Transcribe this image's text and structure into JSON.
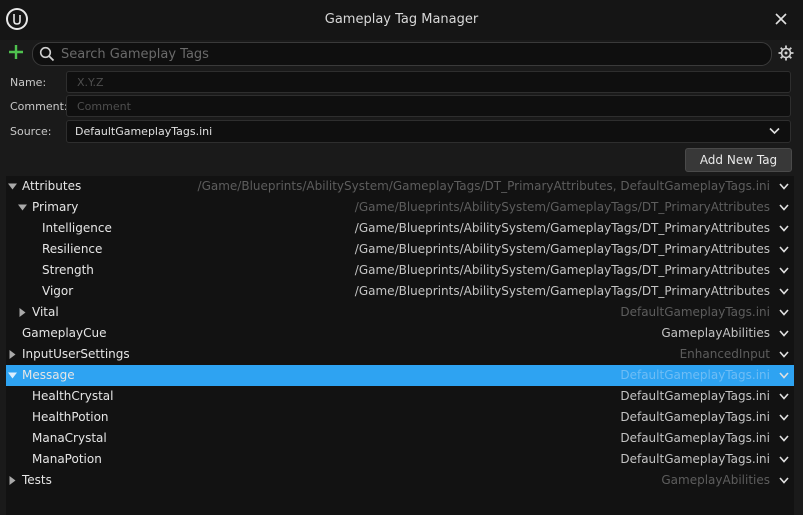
{
  "window": {
    "title": "Gameplay Tag Manager"
  },
  "search": {
    "placeholder": "Search Gameplay Tags"
  },
  "form": {
    "name_label": "Name:",
    "name_placeholder": "X.Y.Z",
    "comment_label": "Comment:",
    "comment_placeholder": "Comment",
    "source_label": "Source:",
    "source_value": "DefaultGameplayTags.ini"
  },
  "add_new_tag_label": "Add New Tag",
  "colors": {
    "selection": "#2ea3f2",
    "add_icon": "#4fc24f",
    "background": "#1a1a1a"
  },
  "tree": [
    {
      "label": "Attributes",
      "source": "/Game/Blueprints/AbilitySystem/GameplayTags/DT_PrimaryAttributes, DefaultGameplayTags.ini",
      "expanded": true,
      "level": 0
    },
    {
      "label": "Primary",
      "source": "/Game/Blueprints/AbilitySystem/GameplayTags/DT_PrimaryAttributes",
      "expanded": true,
      "level": 1
    },
    {
      "label": "Intelligence",
      "source": "/Game/Blueprints/AbilitySystem/GameplayTags/DT_PrimaryAttributes",
      "level": 2
    },
    {
      "label": "Resilience",
      "source": "/Game/Blueprints/AbilitySystem/GameplayTags/DT_PrimaryAttributes",
      "level": 2
    },
    {
      "label": "Strength",
      "source": "/Game/Blueprints/AbilitySystem/GameplayTags/DT_PrimaryAttributes",
      "level": 2
    },
    {
      "label": "Vigor",
      "source": "/Game/Blueprints/AbilitySystem/GameplayTags/DT_PrimaryAttributes",
      "level": 2
    },
    {
      "label": "Vital",
      "source": "DefaultGameplayTags.ini",
      "expanded": false,
      "level": 1
    },
    {
      "label": "GameplayCue",
      "source": "GameplayAbilities",
      "level": 0
    },
    {
      "label": "InputUserSettings",
      "source": "EnhancedInput",
      "expanded": false,
      "level": 0
    },
    {
      "label": "Message",
      "source": "DefaultGameplayTags.ini",
      "expanded": true,
      "level": 0,
      "selected": true
    },
    {
      "label": "HealthCrystal",
      "source": "DefaultGameplayTags.ini",
      "level": 1
    },
    {
      "label": "HealthPotion",
      "source": "DefaultGameplayTags.ini",
      "level": 1
    },
    {
      "label": "ManaCrystal",
      "source": "DefaultGameplayTags.ini",
      "level": 1
    },
    {
      "label": "ManaPotion",
      "source": "DefaultGameplayTags.ini",
      "level": 1
    },
    {
      "label": "Tests",
      "source": "GameplayAbilities",
      "expanded": false,
      "level": 0
    }
  ]
}
